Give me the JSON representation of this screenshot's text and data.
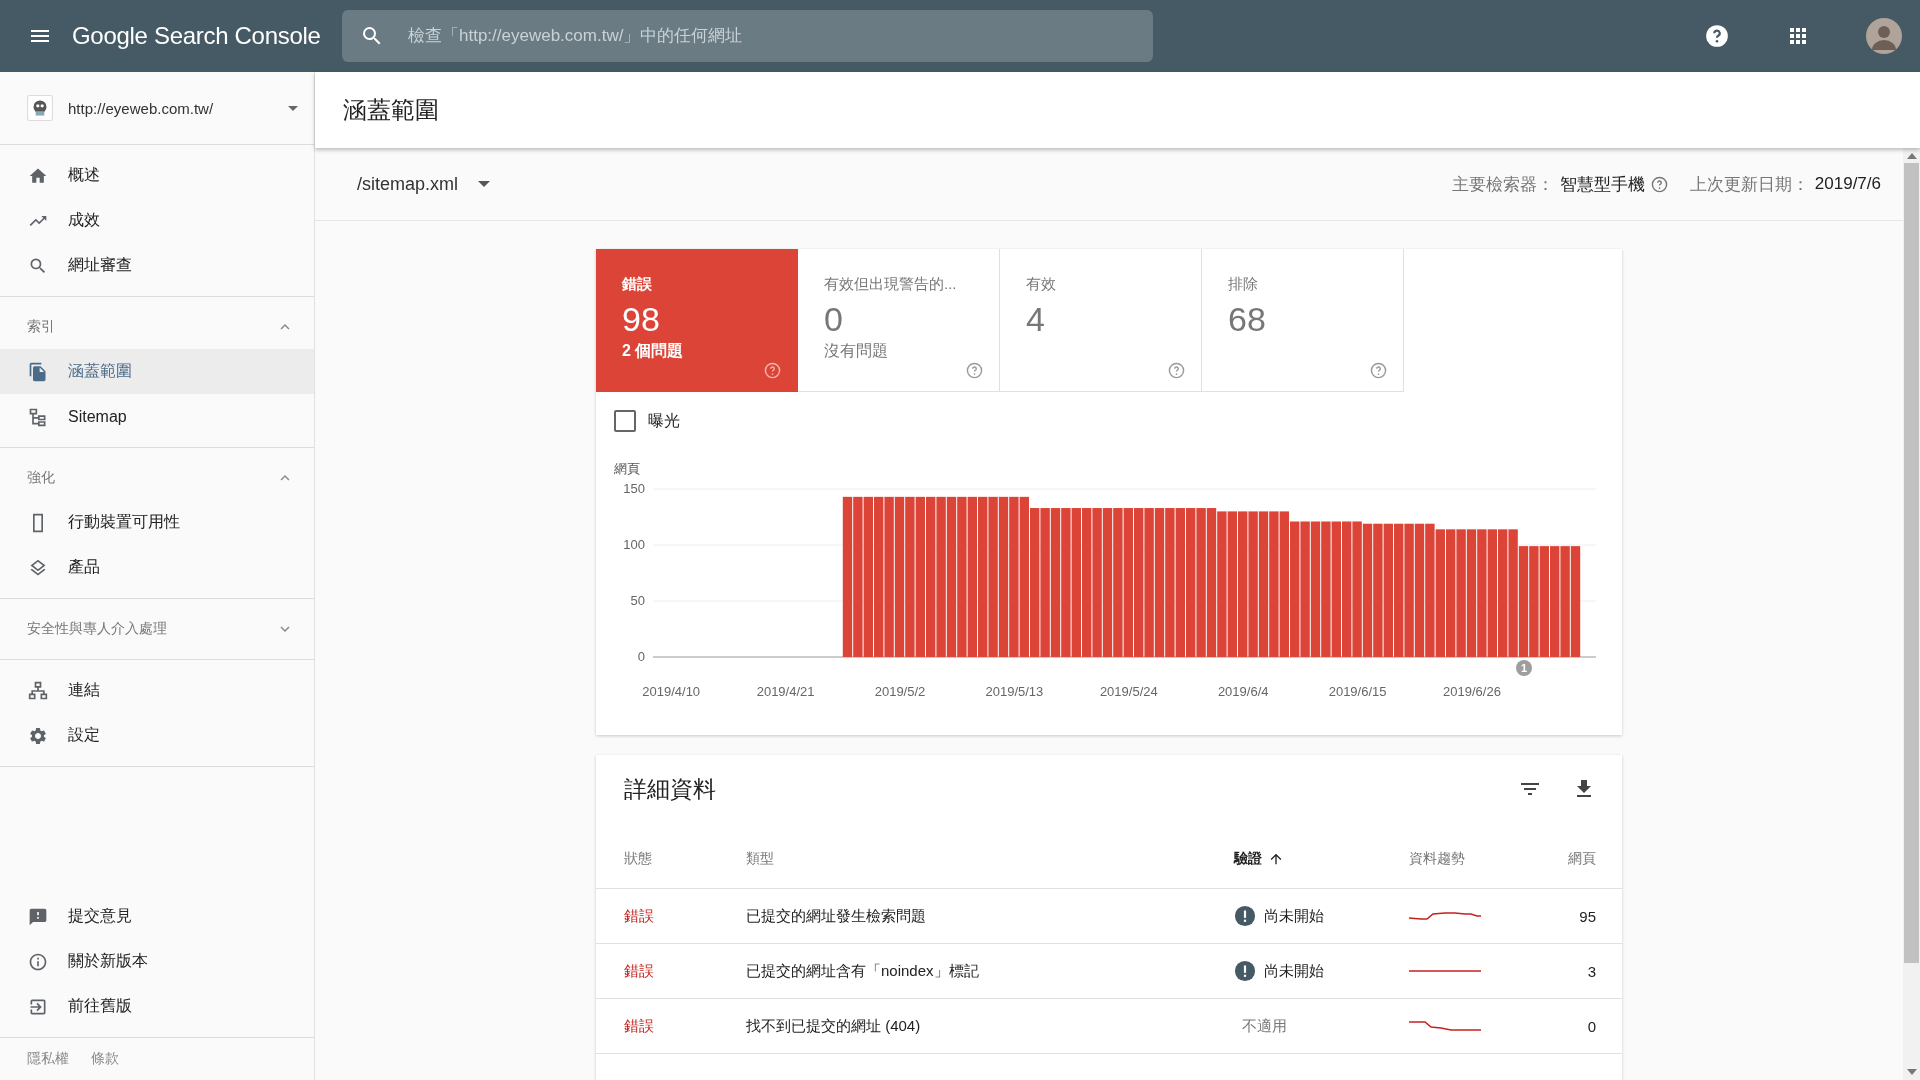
{
  "app": {
    "title": "Google Search Console",
    "search_placeholder": "檢查「http://eyeweb.com.tw/」中的任何網址"
  },
  "sidebar": {
    "property": "http://eyeweb.com.tw/",
    "groups": [
      {
        "items": [
          {
            "label": "概述",
            "selected": false
          },
          {
            "label": "成效",
            "selected": false
          },
          {
            "label": "網址審查",
            "selected": false
          }
        ]
      },
      {
        "title": "索引",
        "expanded": true,
        "items": [
          {
            "label": "涵蓋範圍",
            "selected": true
          },
          {
            "label": "Sitemap",
            "selected": false
          }
        ]
      },
      {
        "title": "強化",
        "expanded": true,
        "items": [
          {
            "label": "行動裝置可用性",
            "selected": false
          },
          {
            "label": "產品",
            "selected": false
          }
        ]
      },
      {
        "title": "安全性與專人介入處理",
        "expanded": false
      },
      {
        "items": [
          {
            "label": "連結",
            "selected": false
          },
          {
            "label": "設定",
            "selected": false
          }
        ]
      }
    ],
    "bottom_items": [
      {
        "label": "提交意見"
      },
      {
        "label": "關於新版本"
      },
      {
        "label": "前往舊版"
      }
    ],
    "footer_links": [
      "隱私權",
      "條款"
    ]
  },
  "page": {
    "title": "涵蓋範圍",
    "sitemap": "/sitemap.xml",
    "crawler_label": "主要檢索器：",
    "crawler": "智慧型手機",
    "updated_label": "上次更新日期：",
    "updated": "2019/7/6"
  },
  "cards": [
    {
      "label": "錯誤",
      "value": "98",
      "note": "2 個問題",
      "selected": true
    },
    {
      "label": "有效但出現警告的...",
      "value": "0",
      "note": "沒有問題",
      "selected": false
    },
    {
      "label": "有效",
      "value": "4",
      "selected": false
    },
    {
      "label": "排除",
      "value": "68",
      "selected": false
    }
  ],
  "impressions": {
    "label": "曝光",
    "checked": false
  },
  "chart_data": {
    "type": "bar",
    "ylabel": "網頁",
    "categories": [
      "2019/4/10",
      null,
      null,
      null,
      null,
      null,
      null,
      null,
      null,
      null,
      null,
      "2019/4/21",
      null,
      null,
      null,
      null,
      null,
      null,
      null,
      null,
      null,
      null,
      "2019/5/2",
      null,
      null,
      null,
      null,
      null,
      null,
      null,
      null,
      null,
      null,
      "2019/5/13",
      null,
      null,
      null,
      null,
      null,
      null,
      null,
      null,
      null,
      null,
      "2019/5/24",
      null,
      null,
      null,
      null,
      null,
      null,
      null,
      null,
      null,
      null,
      "2019/6/4",
      null,
      null,
      null,
      null,
      null,
      null,
      null,
      null,
      null,
      null,
      "2019/6/15",
      null,
      null,
      null,
      null,
      null,
      null,
      null,
      null,
      null,
      null,
      "2019/6/26",
      null,
      null,
      null,
      null,
      null,
      null,
      null,
      null,
      null,
      null
    ],
    "series": [
      {
        "color": "#db4437",
        "values": [
          null,
          null,
          null,
          null,
          null,
          null,
          null,
          null,
          null,
          null,
          null,
          null,
          null,
          null,
          null,
          null,
          null,
          143,
          143,
          143,
          143,
          143,
          143,
          143,
          143,
          143,
          143,
          143,
          143,
          143,
          143,
          143,
          143,
          143,
          143,
          133,
          133,
          133,
          133,
          133,
          133,
          133,
          133,
          133,
          133,
          133,
          133,
          133,
          133,
          133,
          133,
          133,
          133,
          130,
          130,
          130,
          130,
          130,
          130,
          130,
          121,
          121,
          121,
          121,
          121,
          121,
          121,
          119,
          119,
          119,
          119,
          119,
          119,
          119,
          114,
          114,
          114,
          114,
          114,
          114,
          114,
          114,
          99,
          99,
          99,
          99,
          99,
          99
        ]
      }
    ],
    "ylim": [
      0,
      150
    ],
    "yticks": [
      0,
      50,
      100,
      150
    ],
    "annotations": [
      "1"
    ]
  },
  "details": {
    "title": "詳細資料",
    "columns": [
      {
        "label": "狀態",
        "sorted": false
      },
      {
        "label": "類型",
        "sorted": false
      },
      {
        "label": "驗證",
        "sorted": true
      },
      {
        "label": "資料趨勢",
        "sorted": false
      },
      {
        "label": "網頁",
        "sorted": false
      }
    ],
    "rows": [
      {
        "status": "錯誤",
        "type": "已提交的網址發生檢索問題",
        "validation": "尚未開始",
        "validation_alert": true,
        "pages": "95"
      },
      {
        "status": "錯誤",
        "type": "已提交的網址含有「noindex」標記",
        "validation": "尚未開始",
        "validation_alert": true,
        "pages": "3"
      },
      {
        "status": "錯誤",
        "type": "找不到已提交的網址 (404)",
        "validation": "不適用",
        "validation_alert": false,
        "pages": "0"
      }
    ]
  }
}
